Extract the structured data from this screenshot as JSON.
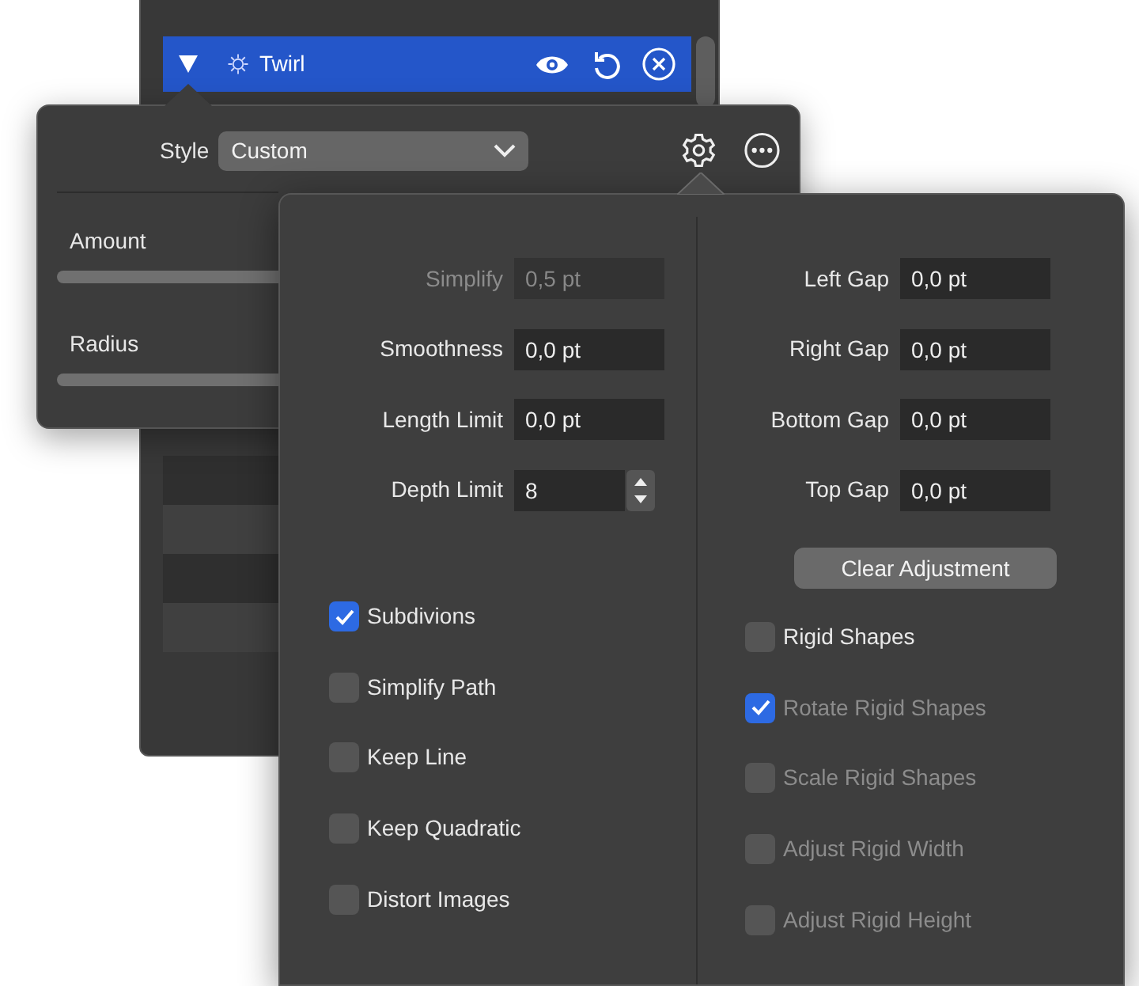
{
  "effect_row": {
    "label": "Twirl",
    "selected": true,
    "expanded": true
  },
  "style_popover": {
    "style_label": "Style",
    "style_value": "Custom",
    "sliders": [
      {
        "label": "Amount"
      },
      {
        "label": "Radius"
      }
    ]
  },
  "settings_popover": {
    "left_fields": [
      {
        "label": "Simplify",
        "value": "0,5 pt",
        "disabled": true,
        "kind": "text"
      },
      {
        "label": "Smoothness",
        "value": "0,0 pt",
        "disabled": false,
        "kind": "text"
      },
      {
        "label": "Length Limit",
        "value": "0,0 pt",
        "disabled": false,
        "kind": "text"
      },
      {
        "label": "Depth Limit",
        "value": "8",
        "disabled": false,
        "kind": "stepper"
      }
    ],
    "right_fields": [
      {
        "label": "Left Gap",
        "value": "0,0 pt",
        "disabled": false
      },
      {
        "label": "Right Gap",
        "value": "0,0 pt",
        "disabled": false
      },
      {
        "label": "Bottom Gap",
        "value": "0,0 pt",
        "disabled": false
      },
      {
        "label": "Top Gap",
        "value": "0,0 pt",
        "disabled": false
      }
    ],
    "clear_button": "Clear Adjustment",
    "left_checks": [
      {
        "label": "Subdivions",
        "checked": true,
        "disabled": false
      },
      {
        "label": "Simplify Path",
        "checked": false,
        "disabled": false
      },
      {
        "label": "Keep Line",
        "checked": false,
        "disabled": false
      },
      {
        "label": "Keep Quadratic",
        "checked": false,
        "disabled": false
      },
      {
        "label": "Distort Images",
        "checked": false,
        "disabled": false
      }
    ],
    "right_checks": [
      {
        "label": "Rigid Shapes",
        "checked": false,
        "disabled": false
      },
      {
        "label": "Rotate Rigid Shapes",
        "checked": true,
        "disabled": true
      },
      {
        "label": "Scale Rigid Shapes",
        "checked": false,
        "disabled": true
      },
      {
        "label": "Adjust Rigid Width",
        "checked": false,
        "disabled": true
      },
      {
        "label": "Adjust Rigid Height",
        "checked": false,
        "disabled": true
      }
    ]
  }
}
